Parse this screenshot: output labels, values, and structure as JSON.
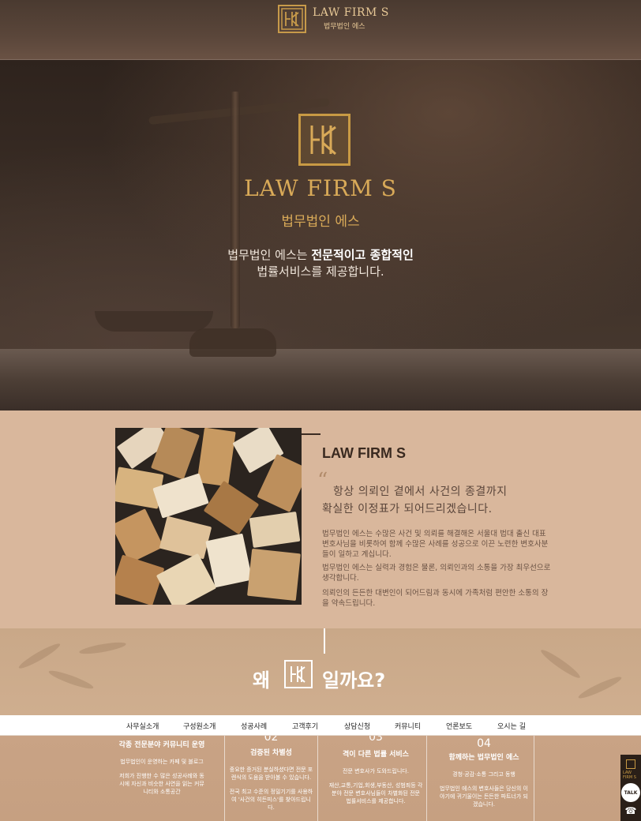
{
  "header": {
    "title": "LAW FIRM S",
    "subtitle": "법무법인 에스",
    "logo_icon": "law-firm-monogram-icon"
  },
  "hero": {
    "title": "LAW FIRM S",
    "subtitle_ko": "법무법인 에스",
    "line1_plain": "법무법인 에스는 ",
    "line1_bold": "전문적이고 종합적인",
    "line2": "법률서비스를 제공합니다."
  },
  "about": {
    "title": "LAW FIRM S",
    "quote_mark": "“",
    "quote_line1": "항상 의뢰인 곁에서 사건의 종결까지",
    "quote_line2": "확실한 이정표가 되어드리겠습니다.",
    "para1": "법무법인 에스는 수많은 사건 및 의뢰를 해결해온 서울대 법대 출신 대표 변호사님을 비롯하여 함께 수많은 사례를 성공으로 이끈 노련한 변호사분들이 일하고 계십니다.",
    "para2": "법무법인 에스는 실력과 경험은 물론, 의뢰인과의 소통을 가장 최우선으로 생각합니다.",
    "para3": "의뢰인의 든든한 대변인이 되어드림과 동시에 가족처럼 편안한 소통의 장을 약속드립니다."
  },
  "why": {
    "left": "왜",
    "right": "일까요?"
  },
  "nav": {
    "items": [
      "사무실소개",
      "구성원소개",
      "성공사례",
      "고객후기",
      "상담신청",
      "커뮤니티",
      "언론보도",
      "오시는 길"
    ]
  },
  "features": [
    {
      "num": "",
      "title": "각종 전문분야 커뮤니티 운영",
      "text1": "법무법인이 운영하는 카페 및 블로그",
      "text2": "저희가 진행한 수 많은 성공사례와 동시에 자신과 비슷한 사연을 읽는 커뮤니티와 소통공간"
    },
    {
      "num": "02",
      "title": "검증된 차별성",
      "text1": "중요한 증거된 분실하셨다면 전문 포렌식의 도움을 받아볼 수 있습니다.",
      "text2": "전국 최고 수준의 정밀기기를 사용하여 '사건의 히든피스'를 찾아드립니다."
    },
    {
      "num": "03",
      "title": "격이 다른 법률 서비스",
      "text1": "전문 변호사가 도와드립니다.",
      "text2": "재산,교통,기업,회생,부동산, 성범죄등 각 분야 전문 변호사님들이 차별화된 전문 법률서비스를 제공합니다."
    },
    {
      "num": "04",
      "title": "함께하는 법무법인 에스",
      "text1": "경청·공감·소통 그리고 동행",
      "text2": "법무법인 에스의 변호사들은 당신의 이야기에 귀기울이는 든든한 파트너가 되겠습니다."
    }
  ],
  "side": {
    "logo_text": "LAW FIRM S",
    "talk_label": "TALK",
    "phone_icon": "phone-icon"
  }
}
